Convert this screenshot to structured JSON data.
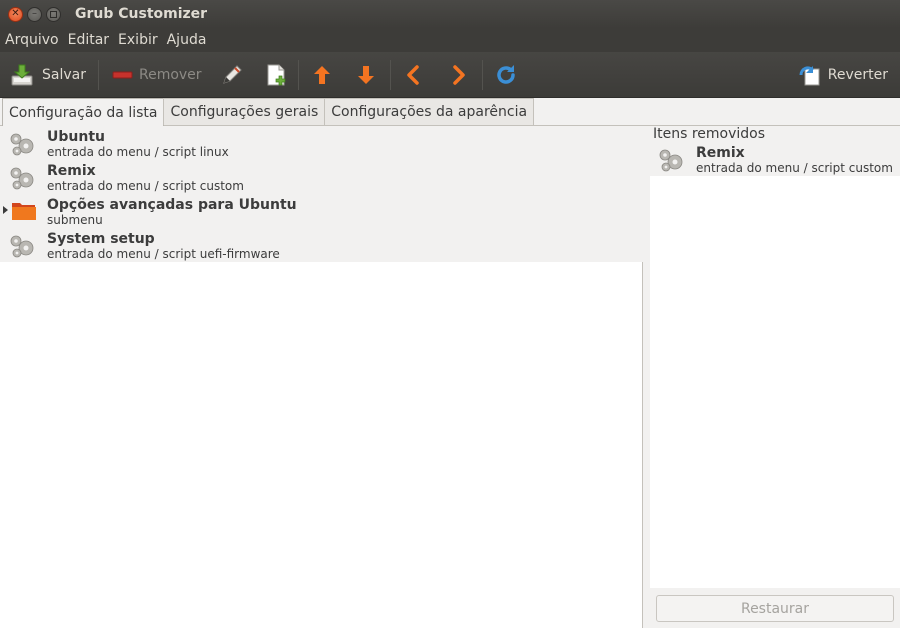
{
  "window": {
    "title": "Grub Customizer"
  },
  "menubar": [
    "Arquivo",
    "Editar",
    "Exibir",
    "Ajuda"
  ],
  "toolbar": {
    "save_label": "Salvar",
    "remove_label": "Remover",
    "revert_label": "Reverter",
    "icons": [
      "save-icon",
      "remove-icon",
      "edit-icon",
      "new-entry-icon",
      "move-up-icon",
      "move-down-icon",
      "move-left-icon",
      "move-right-icon",
      "reload-icon",
      "revert-icon"
    ]
  },
  "tabs": [
    {
      "label": "Configuração da lista",
      "active": true
    },
    {
      "label": "Configurações gerais",
      "active": false
    },
    {
      "label": "Configurações da aparência",
      "active": false
    }
  ],
  "entries": [
    {
      "name": "Ubuntu",
      "subtitle": "entrada do menu / script linux",
      "icon": "gear-icon"
    },
    {
      "name": "Remix",
      "subtitle": "entrada do menu / script custom",
      "icon": "gear-icon"
    },
    {
      "name": "Opções avançadas para Ubuntu",
      "subtitle": "submenu",
      "icon": "folder-icon"
    },
    {
      "name": "System setup",
      "subtitle": "entrada do menu / script uefi-firmware",
      "icon": "gear-icon"
    }
  ],
  "removed_panel": {
    "title": "Itens removidos",
    "items": [
      {
        "name": "Remix",
        "subtitle": "entrada do menu / script custom",
        "icon": "gear-icon"
      }
    ],
    "restore_label": "Restaurar"
  },
  "colors": {
    "header_bg": "#3d3c39",
    "accent_orange": "#f47421",
    "close_button": "#df4a1f",
    "reload_blue": "#3b8fd6"
  }
}
